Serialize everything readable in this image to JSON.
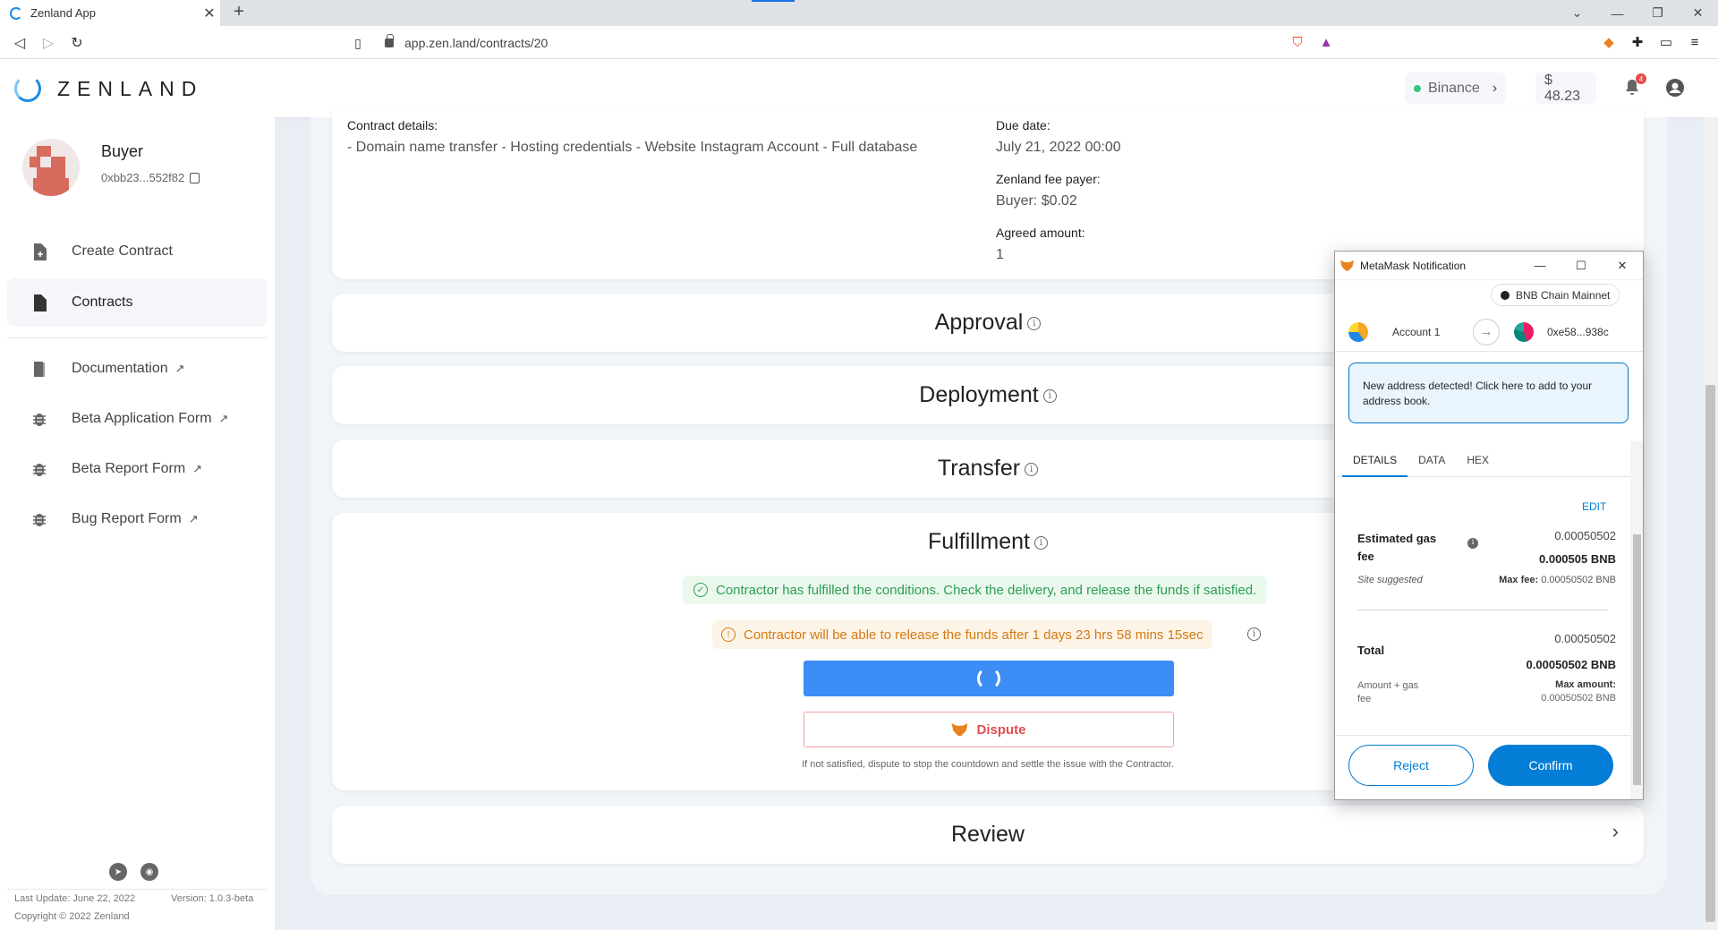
{
  "browser": {
    "tab_title": "Zenland App",
    "url": "app.zen.land/contracts/20"
  },
  "header": {
    "logo_text": "ZENLAND",
    "network": "Binance",
    "balance": "$ 48.23",
    "notification_count": "4"
  },
  "sidebar": {
    "role": "Buyer",
    "address": "0xbb23...552f82",
    "items": [
      {
        "label": "Create Contract",
        "icon": "file-plus-icon"
      },
      {
        "label": "Contracts",
        "icon": "file-icon"
      },
      {
        "label": "Documentation",
        "icon": "book-icon"
      },
      {
        "label": "Beta Application Form",
        "icon": "bug-icon"
      },
      {
        "label": "Beta Report Form",
        "icon": "bug-icon"
      },
      {
        "label": "Bug Report Form",
        "icon": "bug-icon"
      }
    ],
    "last_update": "Last Update: June 22, 2022",
    "version": "Version: 1.0.3-beta",
    "copyright": "Copyright © 2022 Zenland"
  },
  "contract": {
    "details_label": "Contract details:",
    "details_value": "- Domain name transfer - Hosting credentials - Website Instagram Account - Full database",
    "due_label": "Due date:",
    "due_value": "July 21, 2022 00:00",
    "fee_payer_label": "Zenland fee payer:",
    "fee_payer_value": "Buyer: $0.02",
    "agreed_label": "Agreed amount:",
    "agreed_value": "1"
  },
  "sections": {
    "approval": "Approval",
    "deployment": "Deployment",
    "transfer": "Transfer",
    "fulfillment": "Fulfillment",
    "review": "Review"
  },
  "fulfillment": {
    "success_msg": "Contractor has fulfilled the conditions. Check the delivery, and release the funds if satisfied.",
    "warning_msg": "Contractor will be able to release the funds after  1 days 23 hrs 58 mins 15sec",
    "dispute_label": "Dispute",
    "note": "If not satisfied, dispute to stop the countdown and settle the issue with the Contractor."
  },
  "metamask": {
    "title": "MetaMask Notification",
    "network": "BNB Chain Mainnet",
    "account_from": "Account 1",
    "account_to": "0xe58...938c",
    "notice": "New address detected! Click here to add to your address book.",
    "tabs": [
      "DETAILS",
      "DATA",
      "HEX"
    ],
    "edit": "EDIT",
    "gas_label": "Estimated gas fee",
    "gas_value": "0.00050502",
    "gas_bnb": "0.000505 BNB",
    "site_suggested": "Site suggested",
    "max_fee_label": "Max fee:",
    "max_fee_value": "0.00050502 BNB",
    "total_label": "Total",
    "total_value": "0.00050502",
    "total_bnb": "0.00050502 BNB",
    "amount_gas": "Amount + gas fee",
    "max_amount_label": "Max amount:",
    "max_amount_value": "0.00050502 BNB",
    "reject": "Reject",
    "confirm": "Confirm"
  }
}
